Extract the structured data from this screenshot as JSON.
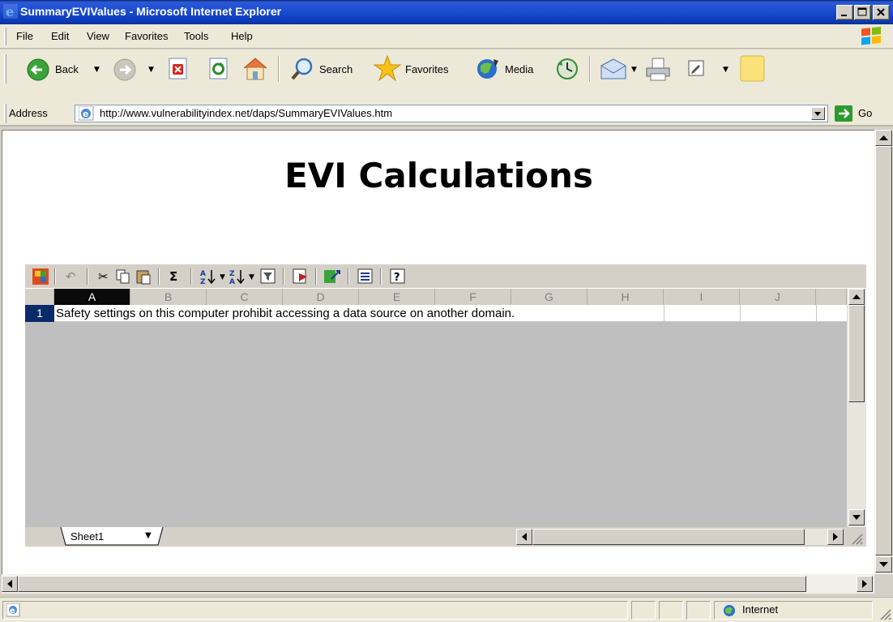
{
  "window": {
    "title": "SummaryEVIValues - Microsoft Internet Explorer",
    "controls": [
      "minimize",
      "maximize",
      "close"
    ]
  },
  "menu": {
    "items": [
      "File",
      "Edit",
      "View",
      "Favorites",
      "Tools",
      "Help"
    ]
  },
  "toolbar": {
    "back_label": "Back",
    "search_label": "Search",
    "favorites_label": "Favorites",
    "media_label": "Media"
  },
  "address": {
    "label": "Address",
    "url": "http://www.vulnerabilityindex.net/daps/SummaryEVIValues.htm",
    "go_label": "Go"
  },
  "page": {
    "heading": "EVI Calculations"
  },
  "spreadsheet": {
    "columns": [
      "A",
      "B",
      "C",
      "D",
      "E",
      "F",
      "G",
      "H",
      "I",
      "J"
    ],
    "selected_column": "A",
    "row_number": "1",
    "cell_text": "Safety settings on this computer prohibit accessing a data source on another domain.",
    "sheet_tab": "Sheet1",
    "toolbar_icons": [
      "office-logo-icon",
      "undo-icon",
      "cut-icon",
      "copy-icon",
      "paste-icon",
      "autosum-icon",
      "sort-ascending-icon",
      "sort-descending-icon",
      "autofilter-icon",
      "refresh-icon",
      "export-icon",
      "commands-options-icon",
      "help-icon"
    ],
    "sigma_glyph": "Σ"
  },
  "status": {
    "zone": "Internet"
  },
  "colors": {
    "titlebar": "#0a246a",
    "chrome": "#ece9d8",
    "sheet_gray": "#bfbfbf",
    "row_header": "#0a2a6a"
  }
}
